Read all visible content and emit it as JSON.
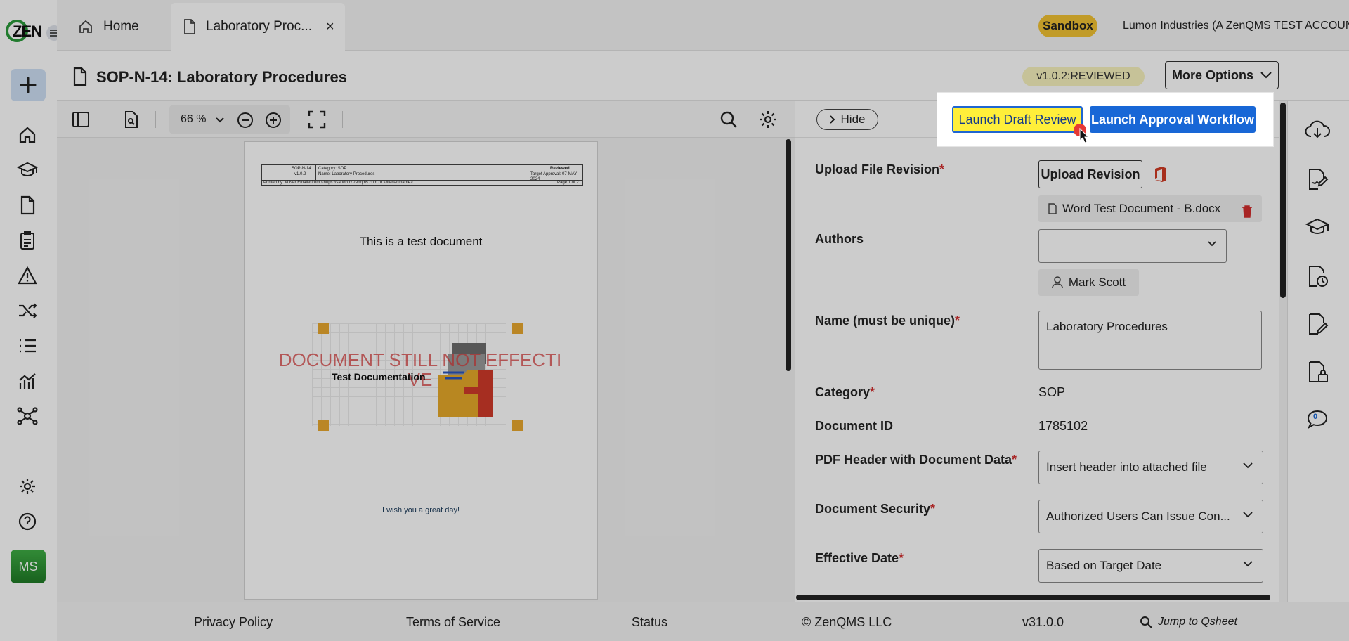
{
  "app": {
    "logo_text": "ZEN",
    "user_initials": "MS"
  },
  "tabs": [
    {
      "label": "Home",
      "icon": "home-icon"
    },
    {
      "label": "Laboratory Proc...",
      "icon": "document-icon",
      "close": "×"
    }
  ],
  "header": {
    "sandbox": "Sandbox",
    "account": "Lumon Industries (A ZenQMS TEST ACCOUNT)"
  },
  "document": {
    "title": "SOP-N-14: Laboratory Procedures",
    "version": "v1.0.2:REVIEWED",
    "more_options": "More Options",
    "close": "×"
  },
  "viewer": {
    "zoom": "66 %",
    "page_header": {
      "doc_id": "SOP-N-14",
      "version": "v1.0.2",
      "category": "Category: SOP",
      "name": "Name: Laboratory Procedures",
      "status": "Reviewed",
      "approved": "Target Approval: 07-MAY-2024",
      "printed": "Printed by: <User Email> from <https://sandbox.zenqms.com or <#tenantname>",
      "page": "Page 1 of 2"
    },
    "heading": "This is a test document",
    "watermark_line1": "DOCUMENT STILL NOT EFFECTI",
    "watermark_line2": "VE",
    "image_label": "Test Documentation",
    "footer_text": "I wish you a great day!"
  },
  "panel": {
    "hide": "Hide",
    "launch_draft_review": "Launch Draft Review",
    "launch_approval_workflow": "Launch Approval Workflow",
    "fields": {
      "upload_file_revision": "Upload File Revision",
      "upload_revision_btn": "Upload Revision",
      "file_name": "Word Test Document - B.docx",
      "authors": "Authors",
      "author_name": "Mark Scott",
      "name_label": "Name (must be unique)",
      "name_value": "Laboratory Procedures",
      "category": "Category",
      "category_value": "SOP",
      "document_id": "Document ID",
      "document_id_value": "1785102",
      "pdf_header": "PDF Header with Document Data",
      "pdf_header_value": "Insert header into attached file",
      "document_security": "Document Security",
      "document_security_value": "Authorized Users Can Issue Con...",
      "effective_date": "Effective Date",
      "effective_date_value": "Based on Target Date",
      "required_mark": "*"
    }
  },
  "right_column": {
    "chat_count": "0"
  },
  "footer": {
    "privacy": "Privacy Policy",
    "terms": "Terms of Service",
    "status": "Status",
    "copyright": "© ZenQMS LLC",
    "version": "v31.0.0",
    "jump": "Jump to Qsheet"
  },
  "colors": {
    "accent": "#1867d6",
    "highlight": "#ffef3a",
    "sandbox": "#f2c232",
    "brand_green": "#2a9a3a"
  }
}
